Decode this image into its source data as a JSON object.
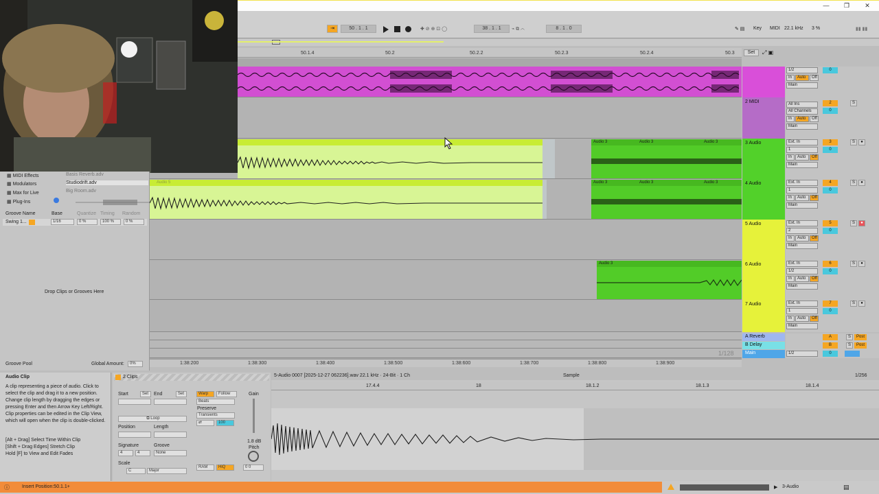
{
  "window": {
    "minimize": "—",
    "restore": "❐",
    "close": "✕"
  },
  "control": {
    "position": "50 . 1 . 1",
    "loop_start": "38 . 1 . 1",
    "loop_length": "8 . 1 . 0",
    "key": "Key",
    "midi": "MIDI",
    "sample_rate": "22.1 kHz",
    "cpu": "3 %"
  },
  "ruler": [
    "50.1.4",
    "50.2",
    "50.2.2",
    "50.2.3",
    "50.2.4",
    "50.3"
  ],
  "set_button": "Set",
  "tracks": [
    {
      "name": "",
      "color": "#d94fd9",
      "io_in": "1/2",
      "io_auto": "Auto",
      "io_off": "Off",
      "io_out": "Main",
      "num": "1",
      "vol": "0"
    },
    {
      "name": "2 MIDI",
      "color": "#b56cc7",
      "io_in": "All Ins",
      "io_ch": "All Channels",
      "io_auto": "Auto",
      "io_off": "Off",
      "io_out": "Main",
      "num": "2",
      "vol": "0"
    },
    {
      "name": "3 Audio",
      "color": "#52d12a",
      "io_in": "Ext. In",
      "io_ch": "1",
      "io_auto": "Auto",
      "io_off": "Off",
      "io_out": "Main",
      "num": "3",
      "vol": "0"
    },
    {
      "name": "4 Audio",
      "color": "#52d12a",
      "io_in": "Ext. In",
      "io_ch": "1",
      "io_auto": "Auto",
      "io_off": "Off",
      "io_out": "Main",
      "num": "4",
      "vol": "0"
    },
    {
      "name": "5 Audio",
      "color": "#e6f23a",
      "io_in": "Ext. In",
      "io_ch": "2",
      "io_auto": "Auto",
      "io_off": "Off",
      "io_out": "Main",
      "num": "5",
      "vol": "0"
    },
    {
      "name": "6 Audio",
      "color": "#e6f23a",
      "io_in": "Ext. In",
      "io_ch": "1/2",
      "io_auto": "Auto",
      "io_off": "Off",
      "io_out": "Main",
      "num": "6",
      "vol": "0"
    },
    {
      "name": "7 Audio",
      "color": "#e6f23a",
      "io_in": "Ext. In",
      "io_ch": "1",
      "io_auto": "Auto",
      "io_off": "Off",
      "io_out": "Main",
      "num": "7",
      "vol": "0"
    }
  ],
  "returns": [
    {
      "name": "A Reverb",
      "num": "A",
      "post": "Post"
    },
    {
      "name": "B Delay",
      "num": "B",
      "post": "Post"
    },
    {
      "name": "Main",
      "io": "1/2",
      "vol": "0"
    }
  ],
  "clips": {
    "audio3": "Audio 3",
    "audio5": "Audio 5"
  },
  "bottom_ruler": [
    "1:38:200",
    "1:38:300",
    "1:38:400",
    "1:38:500",
    "1:38:600",
    "1:38:700",
    "1:38:800",
    "1:38:900"
  ],
  "grid": "1/128",
  "browser": {
    "items": [
      "MIDI Effects",
      "Modulators",
      "Max for Live",
      "Plug-Ins"
    ],
    "files": [
      "Basis Reverb.adv",
      "Studiodrift.adv",
      "Big Room.adv"
    ],
    "groove_headers": [
      "Groove Name",
      "Base",
      "Quantize",
      "Timing",
      "Random"
    ],
    "groove_row": {
      "name": "Swing 1...",
      "base": "1/16",
      "quantize": "0 %",
      "timing": "100 %",
      "random": "0 %"
    },
    "drop_hint": "Drop Clips or Grooves Here",
    "groove_pool": "Groove Pool",
    "global_amount_label": "Global Amount:",
    "global_amount": "0%"
  },
  "info": {
    "title": "Audio Clip",
    "body": "A clip representing a piece of audio. Click to select the clip and drag it to a new position. Change clip length by dragging the edges or pressing Enter and then Arrow Key Left/Right. Clip properties can be edited in the Clip View, which will open when the clip is double-clicked.",
    "hints": "[Alt + Drag] Select Time Within Clip\n[Shift + Drag Edges] Stretch Clip\nHold [F] to View and Edit Fades"
  },
  "clipview": {
    "title": "2 Clips",
    "start": "Start",
    "end": "End",
    "set": "Set",
    "loop": "Loop",
    "position": "Position",
    "length": "Length",
    "signature": "Signature",
    "sig_num": "4",
    "sig_den": "4",
    "groove": "Groove",
    "groove_val": "None",
    "scale": "Scale",
    "scale_root": "C",
    "scale_mode": "Major",
    "warp": "Warp",
    "follow": "Follow",
    "beats": "Beats",
    "preserve": "Preserve",
    "transients": "Transients",
    "env": "100",
    "gain": "Gain",
    "gain_db": "1.8 dB",
    "pitch": "Pitch",
    "ram": "RAM",
    "hiq": "HiQ",
    "pitch_vals": "0   0"
  },
  "sample": {
    "filename": "5-Audio 0007 [2025-12-27 062236].wav  22.1 kHz · 24-Bit · 1 Ch",
    "tab": "Sample",
    "zoom": "1/256",
    "ruler": [
      "17.4.4",
      "18",
      "18.1.2",
      "18.1.3",
      "18.1.4"
    ]
  },
  "status": {
    "text": "Insert Position:50.1.1+",
    "track": "3-Audio"
  },
  "webcam_caption": ""
}
